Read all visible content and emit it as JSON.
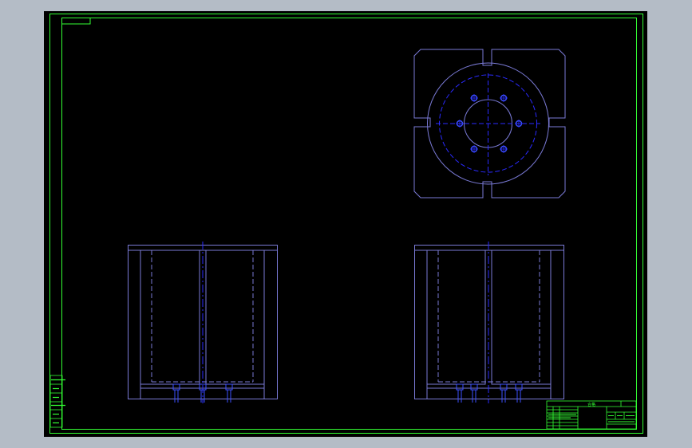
{
  "drawing": {
    "background_color": "#b4bcc6",
    "sheet_color": "#000000",
    "frame_color": "#33ff33",
    "part_color": "#7a7ad6",
    "centerline_color": "#2a2aff",
    "hole_color": "#3c50ff",
    "views": [
      {
        "name": "top-view",
        "type": "plan",
        "bolt_holes": 6
      },
      {
        "name": "front-view-left",
        "type": "section"
      },
      {
        "name": "front-view-right",
        "type": "section"
      }
    ],
    "title_block": {
      "label": "合格"
    },
    "side_stamp_rows": 6
  }
}
